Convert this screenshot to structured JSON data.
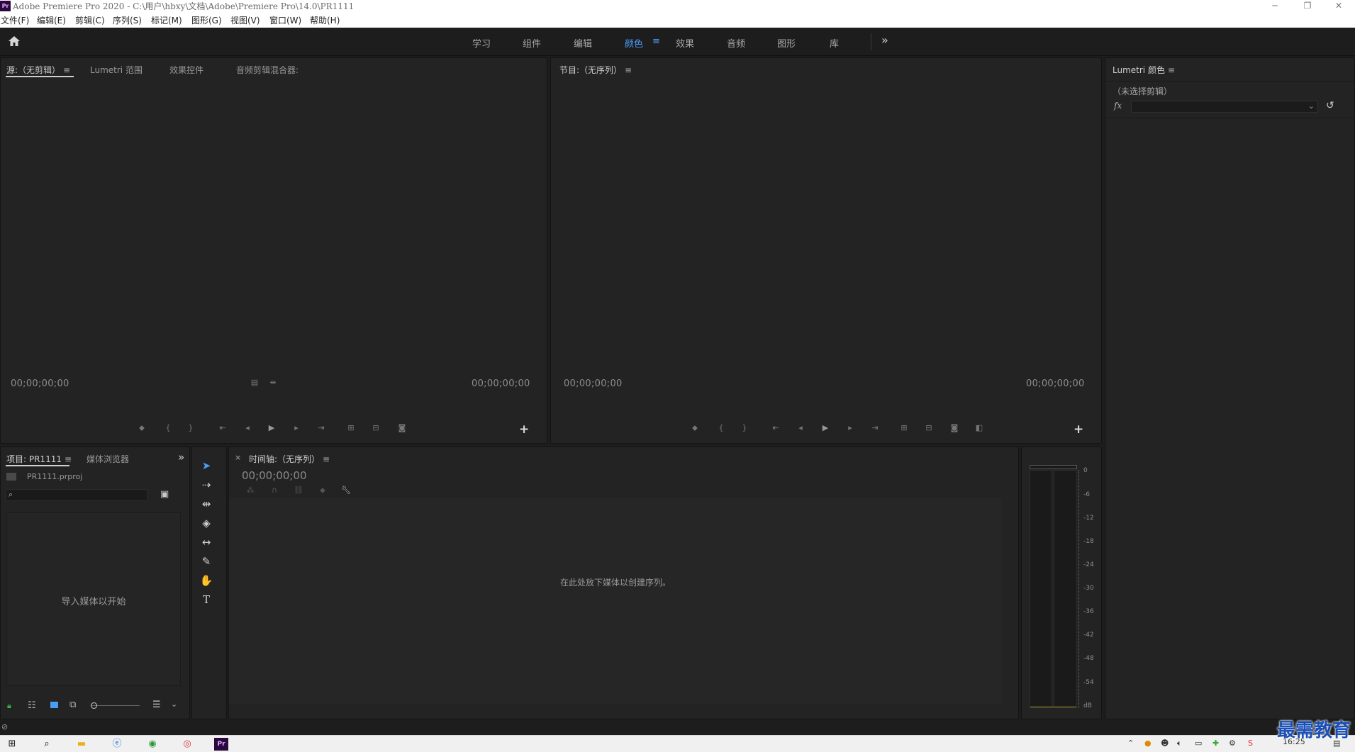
{
  "window": {
    "title": "Adobe Premiere Pro 2020 - C:\\用户\\hbxy\\文档\\Adobe\\Premiere Pro\\14.0\\PR1111",
    "logo": "Pr",
    "controls": {
      "minimize": "─",
      "restore": "❐",
      "close": "✕"
    }
  },
  "menu": [
    "文件(F)",
    "编辑(E)",
    "剪辑(C)",
    "序列(S)",
    "标记(M)",
    "图形(G)",
    "视图(V)",
    "窗口(W)",
    "帮助(H)"
  ],
  "workspaces": {
    "tabs": [
      "学习",
      "组件",
      "编辑",
      "颜色",
      "效果",
      "音频",
      "图形",
      "库"
    ],
    "active": "颜色",
    "menu_glyph": "≡",
    "more": "»"
  },
  "source_panel": {
    "tabs": [
      "源:（无剪辑）",
      "Lumetri 范围",
      "效果控件",
      "音频剪辑混合器:"
    ],
    "timecode_left": "00;00;00;00",
    "timecode_right": "00;00;00;00"
  },
  "program_panel": {
    "title": "节目:（无序列）",
    "timecode_left": "00;00;00;00",
    "timecode_right": "00;00;00;00"
  },
  "lumetri_panel": {
    "title": "Lumetri 颜色",
    "no_clip": "（未选择剪辑）",
    "fx_label": "fx",
    "dropdown_value": ""
  },
  "project_panel": {
    "tabs": [
      "项目: PR1111",
      "媒体浏览器"
    ],
    "file": "PR1111.prproj",
    "search_placeholder": "",
    "empty_hint": "导入媒体以开始"
  },
  "timeline_panel": {
    "title": "时间轴:（无序列）",
    "timecode": "00;00;00;00",
    "empty_hint": "在此处放下媒体以创建序列。"
  },
  "audio_meter": {
    "scale": [
      "0",
      "-6",
      "-12",
      "-18",
      "-24",
      "-30",
      "-36",
      "-42",
      "-48",
      "-54",
      "dB"
    ]
  },
  "taskbar": {
    "clock": "16:25",
    "brand": "最需教育"
  },
  "colors": {
    "accent": "#4b9cf5",
    "panel_bg": "#232323",
    "app_bg": "#1d1d1d",
    "brand": "#1a4fb8"
  }
}
